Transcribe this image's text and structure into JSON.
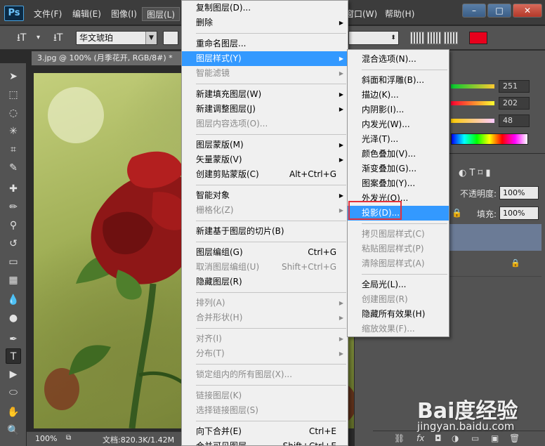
{
  "app": {
    "logo": "Ps"
  },
  "menubar": {
    "items": [
      "文件(F)",
      "编辑(E)",
      "图像(I)",
      "图层(L)",
      "窗口(W)",
      "帮助(H)"
    ],
    "window_buttons": [
      "–",
      "□",
      "✕"
    ]
  },
  "optionsbar": {
    "tool_glyph": "⭳T",
    "orient_glyph": "⭳T",
    "font_family": "华文琥珀",
    "color": "#e8001c"
  },
  "document": {
    "tab_title": "3.jpg @ 100% (月季花开, RGB/8#) *",
    "zoom": "100%",
    "doc_info": "文档:820.3K/1.42M"
  },
  "color_panel": {
    "r_value": "251",
    "g_value": "202",
    "b_value": "48"
  },
  "layers_panel": {
    "opacity_label": "不透明度:",
    "opacity_value": "100%",
    "fill_label": "填充:",
    "fill_value": "100%"
  },
  "layer_menu": {
    "items": [
      {
        "label": "复制图层(D)...",
        "shortcut": "",
        "submenu": false,
        "disabled": false
      },
      {
        "label": "删除",
        "shortcut": "",
        "submenu": true,
        "disabled": false
      },
      {
        "sep": true
      },
      {
        "label": "重命名图层...",
        "shortcut": "",
        "submenu": false,
        "disabled": false
      },
      {
        "label": "图层样式(Y)",
        "shortcut": "",
        "submenu": true,
        "disabled": false,
        "highlight": true
      },
      {
        "label": "智能滤镜",
        "shortcut": "",
        "submenu": true,
        "disabled": true
      },
      {
        "sep": true
      },
      {
        "label": "新建填充图层(W)",
        "shortcut": "",
        "submenu": true,
        "disabled": false
      },
      {
        "label": "新建调整图层(J)",
        "shortcut": "",
        "submenu": true,
        "disabled": false
      },
      {
        "label": "图层内容选项(O)...",
        "shortcut": "",
        "submenu": false,
        "disabled": true
      },
      {
        "sep": true
      },
      {
        "label": "图层蒙版(M)",
        "shortcut": "",
        "submenu": true,
        "disabled": false
      },
      {
        "label": "矢量蒙版(V)",
        "shortcut": "",
        "submenu": true,
        "disabled": false
      },
      {
        "label": "创建剪贴蒙版(C)",
        "shortcut": "Alt+Ctrl+G",
        "submenu": false,
        "disabled": false
      },
      {
        "sep": true
      },
      {
        "label": "智能对象",
        "shortcut": "",
        "submenu": true,
        "disabled": false
      },
      {
        "label": "栅格化(Z)",
        "shortcut": "",
        "submenu": true,
        "disabled": true
      },
      {
        "sep": true
      },
      {
        "label": "新建基于图层的切片(B)",
        "shortcut": "",
        "submenu": false,
        "disabled": false
      },
      {
        "sep": true
      },
      {
        "label": "图层编组(G)",
        "shortcut": "Ctrl+G",
        "submenu": false,
        "disabled": false
      },
      {
        "label": "取消图层编组(U)",
        "shortcut": "Shift+Ctrl+G",
        "submenu": false,
        "disabled": true
      },
      {
        "label": "隐藏图层(R)",
        "shortcut": "",
        "submenu": false,
        "disabled": false
      },
      {
        "sep": true
      },
      {
        "label": "排列(A)",
        "shortcut": "",
        "submenu": true,
        "disabled": true
      },
      {
        "label": "合并形状(H)",
        "shortcut": "",
        "submenu": true,
        "disabled": true
      },
      {
        "sep": true
      },
      {
        "label": "对齐(I)",
        "shortcut": "",
        "submenu": true,
        "disabled": true
      },
      {
        "label": "分布(T)",
        "shortcut": "",
        "submenu": true,
        "disabled": true
      },
      {
        "sep": true
      },
      {
        "label": "锁定组内的所有图层(X)...",
        "shortcut": "",
        "submenu": false,
        "disabled": true
      },
      {
        "sep": true
      },
      {
        "label": "链接图层(K)",
        "shortcut": "",
        "submenu": false,
        "disabled": true
      },
      {
        "label": "选择链接图层(S)",
        "shortcut": "",
        "submenu": false,
        "disabled": true
      },
      {
        "sep": true
      },
      {
        "label": "向下合并(E)",
        "shortcut": "Ctrl+E",
        "submenu": false,
        "disabled": false
      },
      {
        "label": "合并可见图层",
        "shortcut": "Shift+Ctrl+E",
        "submenu": false,
        "disabled": false
      }
    ]
  },
  "style_submenu": {
    "items": [
      {
        "label": "混合选项(N)...",
        "disabled": false
      },
      {
        "sep": true
      },
      {
        "label": "斜面和浮雕(B)...",
        "disabled": false
      },
      {
        "label": "描边(K)...",
        "disabled": false
      },
      {
        "label": "内阴影(I)...",
        "disabled": false
      },
      {
        "label": "内发光(W)...",
        "disabled": false
      },
      {
        "label": "光泽(T)...",
        "disabled": false
      },
      {
        "label": "颜色叠加(V)...",
        "disabled": false
      },
      {
        "label": "渐变叠加(G)...",
        "disabled": false
      },
      {
        "label": "图案叠加(Y)...",
        "disabled": false
      },
      {
        "label": "外发光(O)...",
        "disabled": false
      },
      {
        "label": "投影(D)...",
        "disabled": false,
        "highlight": true
      },
      {
        "sep": true
      },
      {
        "label": "拷贝图层样式(C)",
        "disabled": true
      },
      {
        "label": "粘贴图层样式(P)",
        "disabled": true
      },
      {
        "label": "清除图层样式(A)",
        "disabled": true
      },
      {
        "sep": true
      },
      {
        "label": "全局光(L)...",
        "disabled": false
      },
      {
        "label": "创建图层(R)",
        "disabled": true
      },
      {
        "label": "隐藏所有效果(H)",
        "disabled": false
      },
      {
        "label": "缩放效果(F)...",
        "disabled": true
      }
    ]
  },
  "watermark": {
    "brand": "Bai度经验",
    "url": "jingyan.baidu.com"
  }
}
